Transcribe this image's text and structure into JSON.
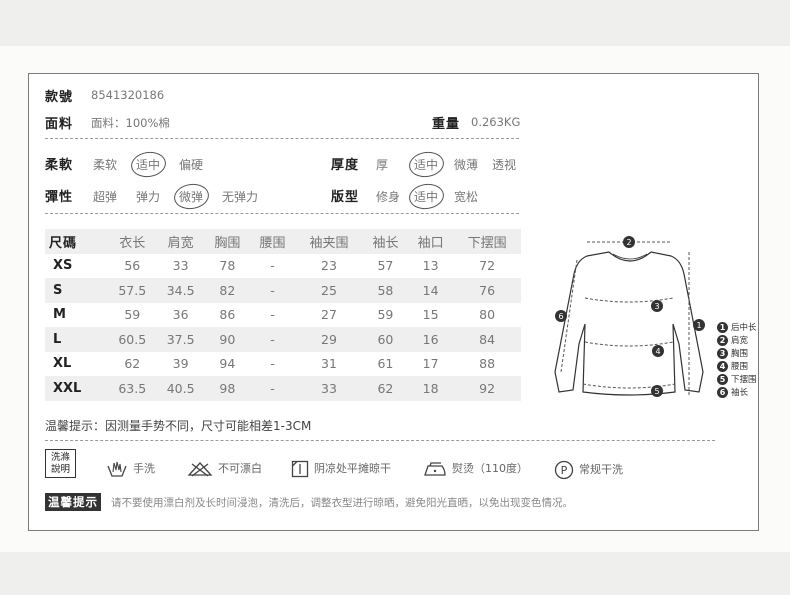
{
  "product": {
    "style_label": "款號",
    "style_value": "8541320186",
    "fabric_label": "面料",
    "fabric_value": "面料：100%棉",
    "weight_label": "重量",
    "weight_value": "0.263KG"
  },
  "attributes": {
    "softness": {
      "label": "柔軟",
      "options": [
        "柔软",
        "适中",
        "偏硬"
      ],
      "selected": "适中"
    },
    "thickness": {
      "label": "厚度",
      "options": [
        "厚",
        "适中",
        "微薄",
        "透视"
      ],
      "selected": "适中"
    },
    "elasticity": {
      "label": "彈性",
      "options": [
        "超弹",
        "弹力",
        "微弹",
        "无弹力"
      ],
      "selected": "微弹"
    },
    "fit": {
      "label": "版型",
      "options": [
        "修身",
        "适中",
        "宽松"
      ],
      "selected": "适中"
    }
  },
  "size_table": {
    "headers": [
      "尺碼",
      "衣长",
      "肩宽",
      "胸围",
      "腰围",
      "袖夹围",
      "袖长",
      "袖口",
      "下摆围"
    ],
    "rows": [
      [
        "XS",
        "56",
        "33",
        "78",
        "-",
        "23",
        "57",
        "13",
        "72"
      ],
      [
        "S",
        "57.5",
        "34.5",
        "82",
        "-",
        "25",
        "58",
        "14",
        "76"
      ],
      [
        "M",
        "59",
        "36",
        "86",
        "-",
        "27",
        "59",
        "15",
        "80"
      ],
      [
        "L",
        "60.5",
        "37.5",
        "90",
        "-",
        "29",
        "60",
        "16",
        "84"
      ],
      [
        "XL",
        "62",
        "39",
        "94",
        "-",
        "31",
        "61",
        "17",
        "88"
      ],
      [
        "XXL",
        "63.5",
        "40.5",
        "98",
        "-",
        "33",
        "62",
        "18",
        "92"
      ]
    ]
  },
  "size_note": "温馨提示：因测量手势不同，尺寸可能相差1-3CM",
  "diagram": {
    "markers": [
      "1",
      "2",
      "3",
      "4",
      "5",
      "6"
    ],
    "legend": [
      {
        "num": "1",
        "text": "后中长"
      },
      {
        "num": "2",
        "text": "肩宽"
      },
      {
        "num": "3",
        "text": "胸围"
      },
      {
        "num": "4",
        "text": "腰围"
      },
      {
        "num": "5",
        "text": "下摆围"
      },
      {
        "num": "6",
        "text": "袖长"
      }
    ]
  },
  "care": {
    "title_line1": "洗滌",
    "title_line2": "說明",
    "items": [
      {
        "icon": "hand-wash-icon",
        "text": "手洗"
      },
      {
        "icon": "no-bleach-icon",
        "text": "不可漂白"
      },
      {
        "icon": "dry-flat-shade-icon",
        "text": "阴凉处平摊晾干"
      },
      {
        "icon": "iron-icon",
        "text": "熨烫（110度）"
      },
      {
        "icon": "dry-clean-icon",
        "text": "常规干洗"
      }
    ]
  },
  "tip": {
    "label": "温馨提示",
    "text": "请不要使用漂白剂及长时间浸泡，清洗后，调整衣型进行晾晒，避免阳光直晒，以免出现变色情况。"
  },
  "colors": {
    "accent_dark": "#333333",
    "row_shade": "#efefef",
    "border": "#7a7a7a"
  }
}
